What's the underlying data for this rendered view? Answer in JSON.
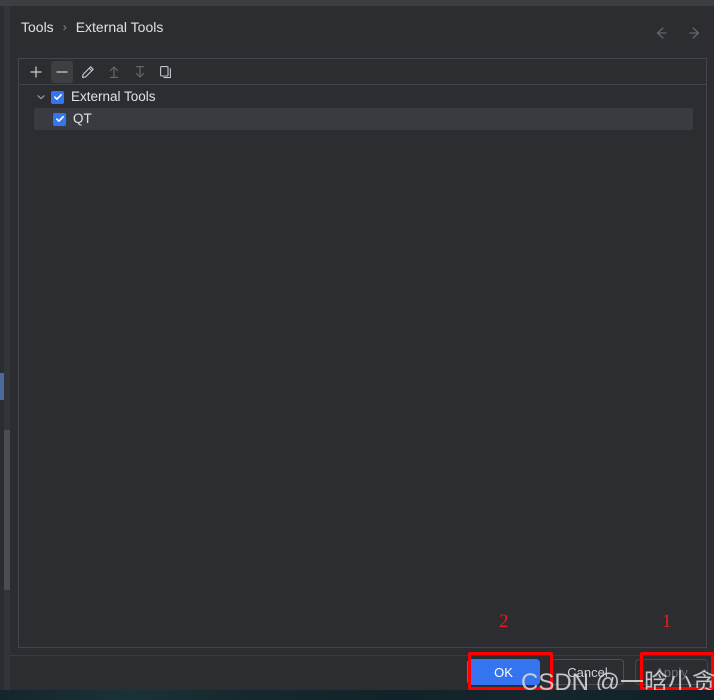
{
  "window": {
    "background_color": "#2b2d30",
    "panel_border_color": "#43454a"
  },
  "header": {
    "breadcrumb": {
      "items": [
        "Tools",
        "External Tools"
      ],
      "separator": "›"
    },
    "nav": {
      "back_label": "Back",
      "back_icon": "arrow-left-icon",
      "forward_label": "Forward",
      "forward_icon": "arrow-right-icon"
    }
  },
  "toolbar": {
    "buttons": [
      {
        "name": "add-button",
        "icon": "plus-icon",
        "label": "Add",
        "state": "enabled"
      },
      {
        "name": "remove-button",
        "icon": "minus-icon",
        "label": "Remove",
        "state": "hover"
      },
      {
        "name": "edit-button",
        "icon": "pencil-icon",
        "label": "Edit",
        "state": "enabled"
      },
      {
        "name": "move-up-button",
        "icon": "arrow-up-icon",
        "label": "Move Up",
        "state": "disabled"
      },
      {
        "name": "move-down-button",
        "icon": "arrow-down-icon",
        "label": "Move Down",
        "state": "disabled"
      },
      {
        "name": "copy-button",
        "icon": "copy-icon",
        "label": "Copy",
        "state": "enabled"
      }
    ]
  },
  "tree": {
    "nodes": [
      {
        "label": "External Tools",
        "checked": true,
        "expanded": true,
        "selected": false,
        "twisty_icon": "chevron-down-icon"
      },
      {
        "label": "QT",
        "checked": true,
        "selected": true,
        "child": true
      }
    ]
  },
  "footer": {
    "ok_label": "OK",
    "cancel_label": "Cancel",
    "apply_label": "Apply",
    "apply_enabled": false,
    "accent_color": "#3574f0"
  },
  "annotations": {
    "color": "#ff0000",
    "markers": [
      {
        "number": "1",
        "target": "apply-button"
      },
      {
        "number": "2",
        "target": "ok-button"
      }
    ]
  },
  "watermark": {
    "text": "CSDN @一晗小贪欢"
  }
}
